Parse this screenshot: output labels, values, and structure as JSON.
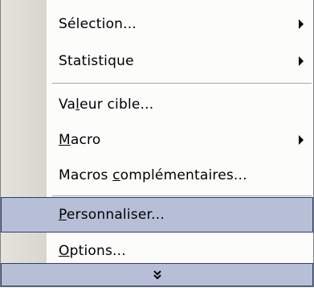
{
  "menu": {
    "items": [
      {
        "id": "selection",
        "pre": "Sélection...",
        "ul": "",
        "post": "",
        "submenu": true
      },
      {
        "id": "statistique",
        "pre": "Statistique",
        "ul": "",
        "post": "",
        "submenu": true
      },
      {
        "id": "valeur-cible",
        "pre": "Va",
        "ul": "l",
        "post": "eur cible...",
        "submenu": false
      },
      {
        "id": "macro",
        "pre": "",
        "ul": "M",
        "post": "acro",
        "submenu": true
      },
      {
        "id": "macros-complementaires",
        "pre": "Macros ",
        "ul": "c",
        "post": "omplémentaires...",
        "submenu": false
      },
      {
        "id": "personnaliser",
        "pre": "",
        "ul": "P",
        "post": "ersonnaliser...",
        "submenu": false,
        "highlighted": true
      },
      {
        "id": "options",
        "pre": "",
        "ul": "O",
        "post": "ptions...",
        "submenu": false
      }
    ],
    "expand_icon": "double-chevron-down-icon",
    "highlight_color": "#b7bfd7"
  }
}
